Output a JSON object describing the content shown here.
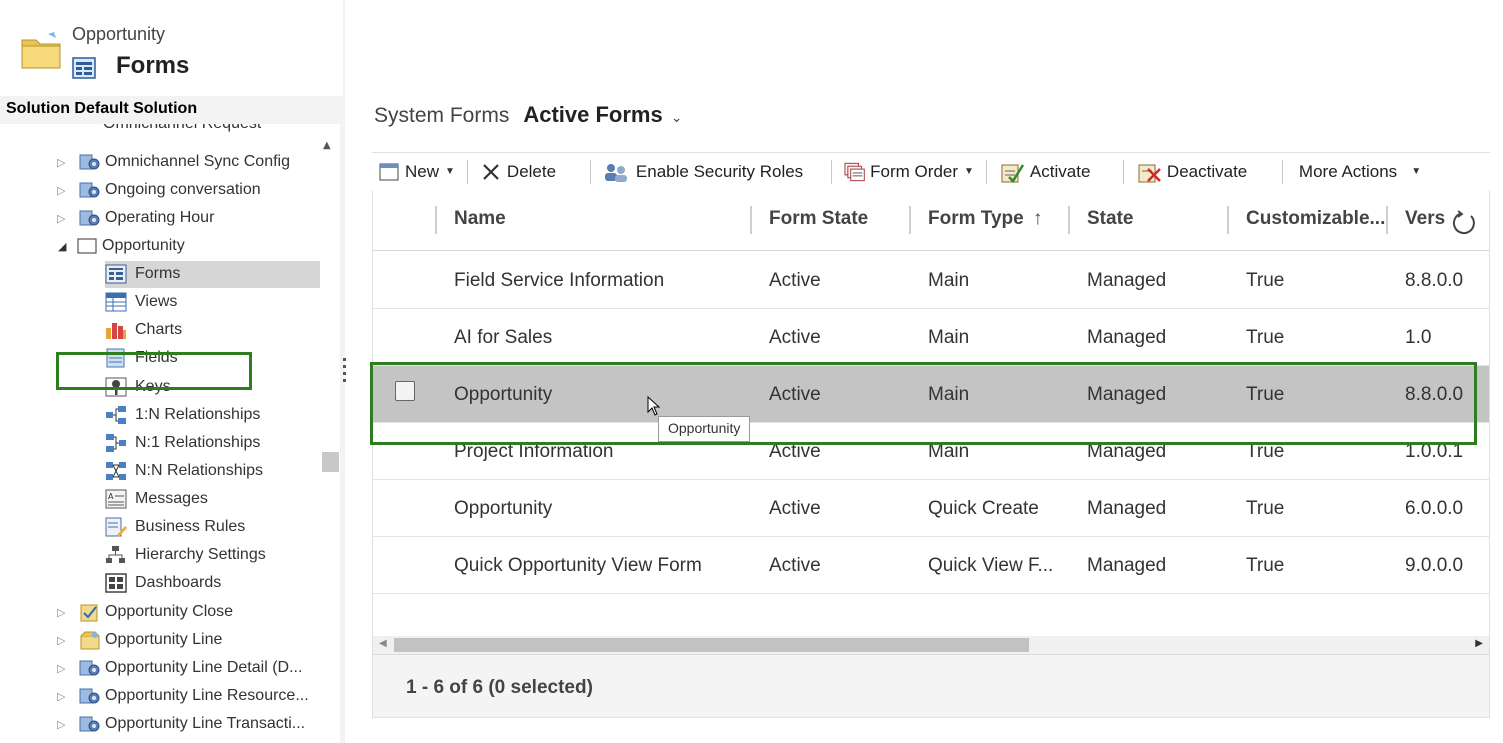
{
  "header": {
    "entity_name": "Opportunity",
    "page_title": "Forms",
    "solution_label": "Solution Default Solution"
  },
  "tree": {
    "items": [
      {
        "label": "Omnichannel Request",
        "icon": "entity-gear-icon",
        "expanded": false
      },
      {
        "label": "Omnichannel Sync Config",
        "icon": "entity-gear-icon",
        "expanded": false
      },
      {
        "label": "Ongoing conversation",
        "icon": "entity-gear-icon",
        "expanded": false
      },
      {
        "label": "Operating Hour",
        "icon": "entity-gear-icon",
        "expanded": false
      },
      {
        "label": "Opportunity",
        "icon": "entity-icon",
        "expanded": true
      }
    ],
    "children": [
      {
        "label": "Forms",
        "icon": "forms-icon",
        "selected": true
      },
      {
        "label": "Views",
        "icon": "views-icon"
      },
      {
        "label": "Charts",
        "icon": "charts-icon"
      },
      {
        "label": "Fields",
        "icon": "fields-icon"
      },
      {
        "label": "Keys",
        "icon": "keys-icon"
      },
      {
        "label": "1:N Relationships",
        "icon": "relationship-icon"
      },
      {
        "label": "N:1 Relationships",
        "icon": "relationship-icon"
      },
      {
        "label": "N:N Relationships",
        "icon": "relationship-icon"
      },
      {
        "label": "Messages",
        "icon": "messages-icon"
      },
      {
        "label": "Business Rules",
        "icon": "business-rules-icon"
      },
      {
        "label": "Hierarchy Settings",
        "icon": "hierarchy-icon"
      },
      {
        "label": "Dashboards",
        "icon": "dashboards-icon"
      }
    ],
    "after_items": [
      {
        "label": "Opportunity Close",
        "icon": "entity-check-icon"
      },
      {
        "label": "Opportunity Line",
        "icon": "entity-box-icon"
      },
      {
        "label": "Opportunity Line Detail (D...",
        "icon": "entity-gear-icon"
      },
      {
        "label": "Opportunity Line Resource...",
        "icon": "entity-gear-icon"
      },
      {
        "label": "Opportunity Line Transacti...",
        "icon": "entity-gear-icon"
      }
    ]
  },
  "view": {
    "prefix": "System Forms",
    "name": "Active Forms"
  },
  "toolbar": {
    "new_label": "New",
    "delete_label": "Delete",
    "enable_security_roles_label": "Enable Security Roles",
    "form_order_label": "Form Order",
    "activate_label": "Activate",
    "deactivate_label": "Deactivate",
    "more_actions_label": "More Actions"
  },
  "grid": {
    "columns": [
      "Name",
      "Form State",
      "Form Type",
      "State",
      "Customizable...",
      "Vers"
    ],
    "sort_indicator": "↑",
    "rows": [
      {
        "name": "Field Service Information",
        "form_state": "Active",
        "form_type": "Main",
        "state": "Managed",
        "customizable": "True",
        "version": "8.8.0.0"
      },
      {
        "name": "AI for Sales",
        "form_state": "Active",
        "form_type": "Main",
        "state": "Managed",
        "customizable": "True",
        "version": "1.0"
      },
      {
        "name": "Opportunity",
        "form_state": "Active",
        "form_type": "Main",
        "state": "Managed",
        "customizable": "True",
        "version": "8.8.0.0"
      },
      {
        "name": "Project Information",
        "form_state": "Active",
        "form_type": "Main",
        "state": "Managed",
        "customizable": "True",
        "version": "1.0.0.1"
      },
      {
        "name": "Opportunity",
        "form_state": "Active",
        "form_type": "Quick Create",
        "state": "Managed",
        "customizable": "True",
        "version": "6.0.0.0"
      },
      {
        "name": "Quick Opportunity View Form",
        "form_state": "Active",
        "form_type": "Quick View F...",
        "state": "Managed",
        "customizable": "True",
        "version": "9.0.0.0"
      }
    ],
    "tooltip": "Opportunity",
    "status": "1 - 6 of 6 (0 selected)"
  },
  "colors": {
    "highlight_border": "#2e7d1f",
    "selected_row": "#c4c4c4",
    "tree_selected": "#d6d6d6"
  }
}
